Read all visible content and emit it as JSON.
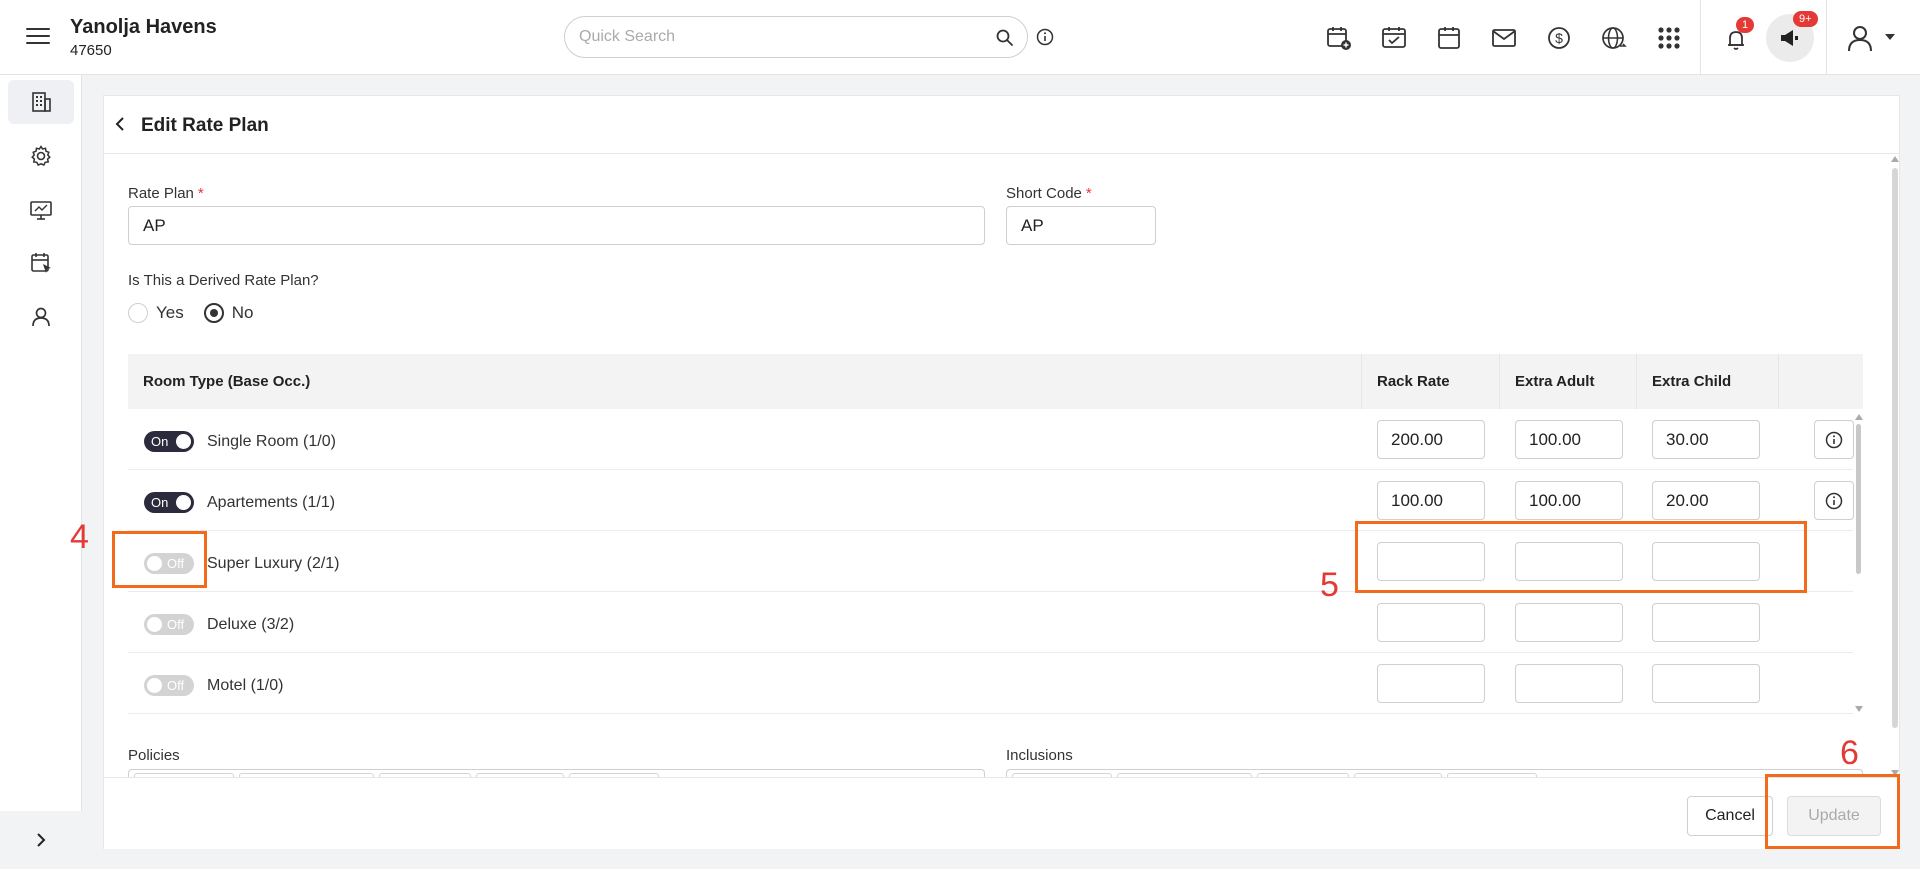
{
  "header": {
    "brand_name": "Yanolja Havens",
    "property_id": "47650",
    "search_placeholder": "Quick Search",
    "notification_count": "1",
    "announcement_count": "9+",
    "icons": [
      "calendar-add-icon",
      "calendar-check-icon",
      "calendar-icon",
      "mail-icon",
      "dollar-icon",
      "globe-icon",
      "apps-grid-icon",
      "bell-icon",
      "megaphone-icon",
      "user-icon"
    ]
  },
  "sidebar": {
    "items": [
      "building-icon",
      "gear-icon",
      "monitor-icon",
      "calendar-cursor-icon",
      "user-icon"
    ],
    "expand_glyph": ">"
  },
  "panel": {
    "title": "Edit Rate Plan",
    "rate_plan_label": "Rate Plan",
    "rate_plan_value": "AP",
    "short_code_label": "Short Code",
    "short_code_value": "AP",
    "required_mark": "*",
    "derived_question": "Is This a Derived Rate Plan?",
    "derived_yes": "Yes",
    "derived_no": "No",
    "derived_selected": "No"
  },
  "table": {
    "headers": {
      "room_type": "Room Type (Base Occ.)",
      "rack_rate": "Rack Rate",
      "extra_adult": "Extra Adult",
      "extra_child": "Extra Child"
    },
    "rows": [
      {
        "state": "On",
        "room": "Single Room (1/0)",
        "rack_rate": "200.00",
        "extra_adult": "100.00",
        "extra_child": "30.00",
        "info": true
      },
      {
        "state": "On",
        "room": "Apartements (1/1)",
        "rack_rate": "100.00",
        "extra_adult": "100.00",
        "extra_child": "20.00",
        "info": true
      },
      {
        "state": "Off",
        "room": "Super Luxury (2/1)",
        "rack_rate": "",
        "extra_adult": "",
        "extra_child": "",
        "info": false
      },
      {
        "state": "Off",
        "room": "Deluxe (3/2)",
        "rack_rate": "",
        "extra_adult": "",
        "extra_child": "",
        "info": false
      },
      {
        "state": "Off",
        "room": "Motel (1/0)",
        "rack_rate": "",
        "extra_adult": "",
        "extra_child": "",
        "info": false
      }
    ]
  },
  "bottom": {
    "policies_label": "Policies",
    "inclusions_label": "Inclusions"
  },
  "footer": {
    "cancel_label": "Cancel",
    "update_label": "Update"
  },
  "annotations": [
    "4",
    "5",
    "6"
  ],
  "colors": {
    "accent_dark": "#2b2b3d",
    "annotation_box": "#f26a1b",
    "annotation_text": "#e53935",
    "badge": "#e53935"
  }
}
